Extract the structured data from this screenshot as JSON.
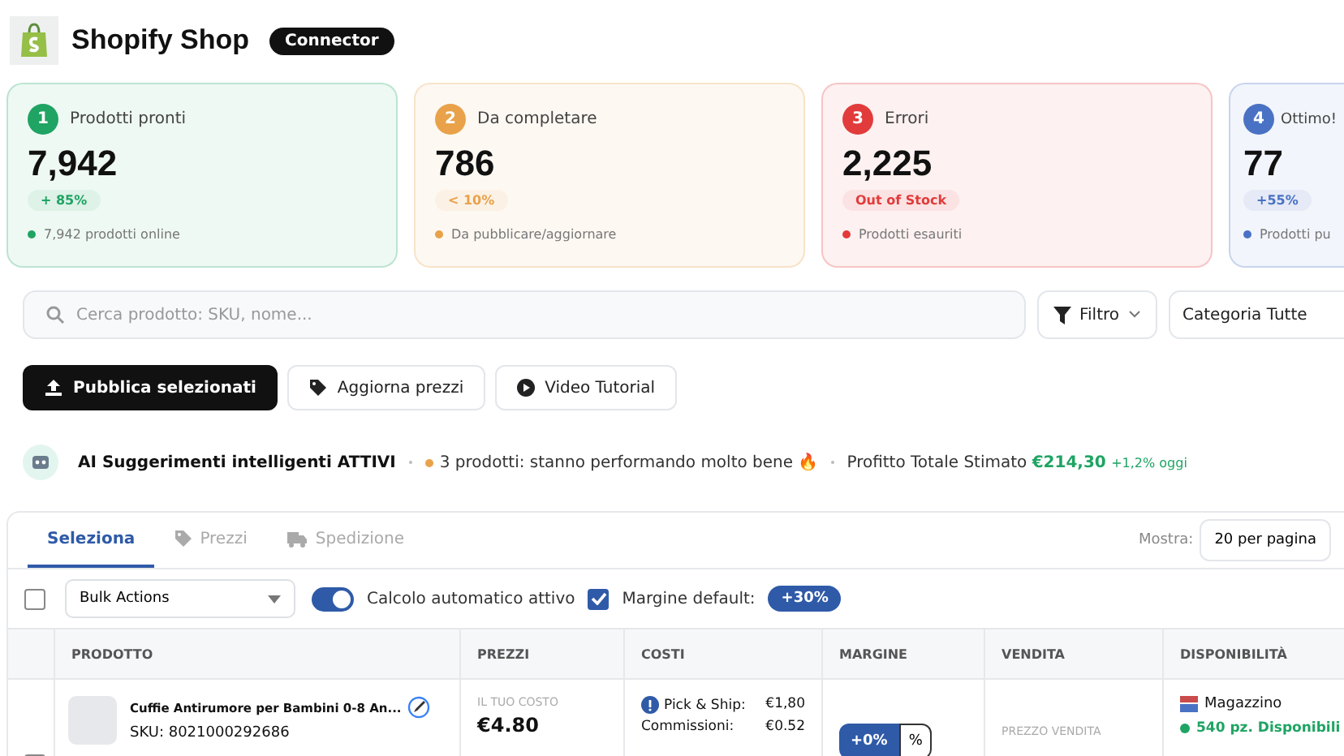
{
  "header": {
    "title": "Shopify Shop",
    "badge": "Connector"
  },
  "stat_cards": [
    {
      "number": "1",
      "label": "Prodotti pronti",
      "value": "7,942",
      "trend": "+ 85%",
      "note": "7,942 prodotti online",
      "color": "#1fa463"
    },
    {
      "number": "2",
      "label": "Da completare",
      "value": "786",
      "trend": "< 10%",
      "note": "Da pubblicare/aggiornare",
      "color": "#e9a24a"
    },
    {
      "number": "3",
      "label": "Errori",
      "value": "2,225",
      "trend": "Out of Stock",
      "note": "Prodotti esauriti",
      "color": "#e23b3b"
    },
    {
      "number": "4",
      "label": "Ottimo!",
      "value": "77",
      "trend": "+55%",
      "note": "Prodotti pu",
      "color": "#4a72c4"
    }
  ],
  "search": {
    "placeholder": "Cerca prodotto: SKU, nome..."
  },
  "filter_button": "Filtro",
  "category_select": "Categoria Tutte",
  "actions": [
    {
      "label": "Pubblica selezionati",
      "kind": "upload",
      "primary": true
    },
    {
      "label": "Aggiorna prezzi",
      "kind": "tag",
      "primary": false
    },
    {
      "label": "Video Tutorial",
      "kind": "play",
      "primary": false
    }
  ],
  "ai_bar": {
    "title": "AI Suggerimenti intelligenti ATTIVI",
    "insight": "3 prodotti: stanno performando molto bene 🔥",
    "profit_label": "Profitto Totale Stimato",
    "profit_value": "€214,30",
    "profit_change": "+1,2% oggi"
  },
  "tabs": [
    {
      "label": "Seleziona",
      "kind": "none",
      "selected": true
    },
    {
      "label": "Prezzi",
      "kind": "tag",
      "selected": false
    },
    {
      "label": "Spedizione",
      "kind": "truck",
      "selected": false
    }
  ],
  "page_size": {
    "label": "Mostra:",
    "value": "20 per pagina"
  },
  "toolbar": {
    "select_all": false,
    "bulk_actions": "Bulk Actions",
    "auto_calc": {
      "label": "Calcolo automatico attivo",
      "on": true
    },
    "margin_default": {
      "checked": true,
      "label": "Margine default:",
      "value": "+30%"
    }
  },
  "table": {
    "columns": [
      "PRODOTTO",
      "PREZZI",
      "COSTI",
      "MARGINE",
      "VENDITA",
      "DISPONIBILITÀ"
    ],
    "rows": [
      {
        "selected": false,
        "name": "Cuffie Antirumore per Bambini 0-8 An...",
        "sku": "SKU: 8021000292686",
        "cost_label": "IL TUO COSTO",
        "cost": "€4.80",
        "costs": [
          {
            "label": "Pick & Ship:",
            "value": "€1,80"
          },
          {
            "label": "Commissioni:",
            "value": "€0.52"
          }
        ],
        "margin_value": "+0%",
        "margin_unit": "%",
        "sale_label": "PREZZO VENDITA",
        "warehouse": "Magazzino",
        "stock": "540 pz. Disponibili"
      }
    ]
  }
}
